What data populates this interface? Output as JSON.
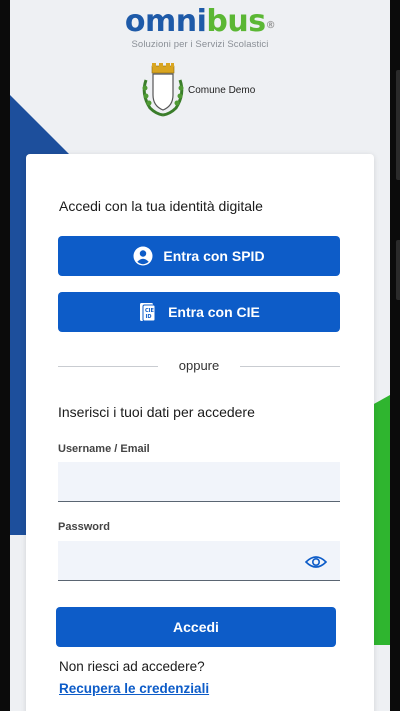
{
  "brand": {
    "logo_part1": "omni",
    "logo_part2": "bus",
    "logo_reg": "®",
    "tagline": "Soluzioni per i Servizi Scolastici",
    "comune_name": "Comune Demo"
  },
  "login": {
    "title": "Accedi con la tua identità digitale",
    "spid_label": "Entra con SPID",
    "cie_label": "Entra con CIE",
    "divider_text": "oppure",
    "subtitle": "Inserisci i tuoi dati per accedere",
    "username_label": "Username / Email",
    "username_value": "",
    "password_label": "Password",
    "password_value": "",
    "submit_label": "Accedi",
    "help_text": "Non riesci ad accedere?",
    "recover_link": "Recupera le credenziali"
  },
  "colors": {
    "primary": "#0d5cc8",
    "brand_blue": "#1e5aa8",
    "brand_green": "#5bb734",
    "accent_orange": "#f5a623",
    "deco_blue": "#1d4f9c",
    "deco_green": "#2fb52f"
  },
  "icons": {
    "spid": "user-circle-icon",
    "cie": "id-card-icon",
    "password_toggle": "eye-icon"
  }
}
